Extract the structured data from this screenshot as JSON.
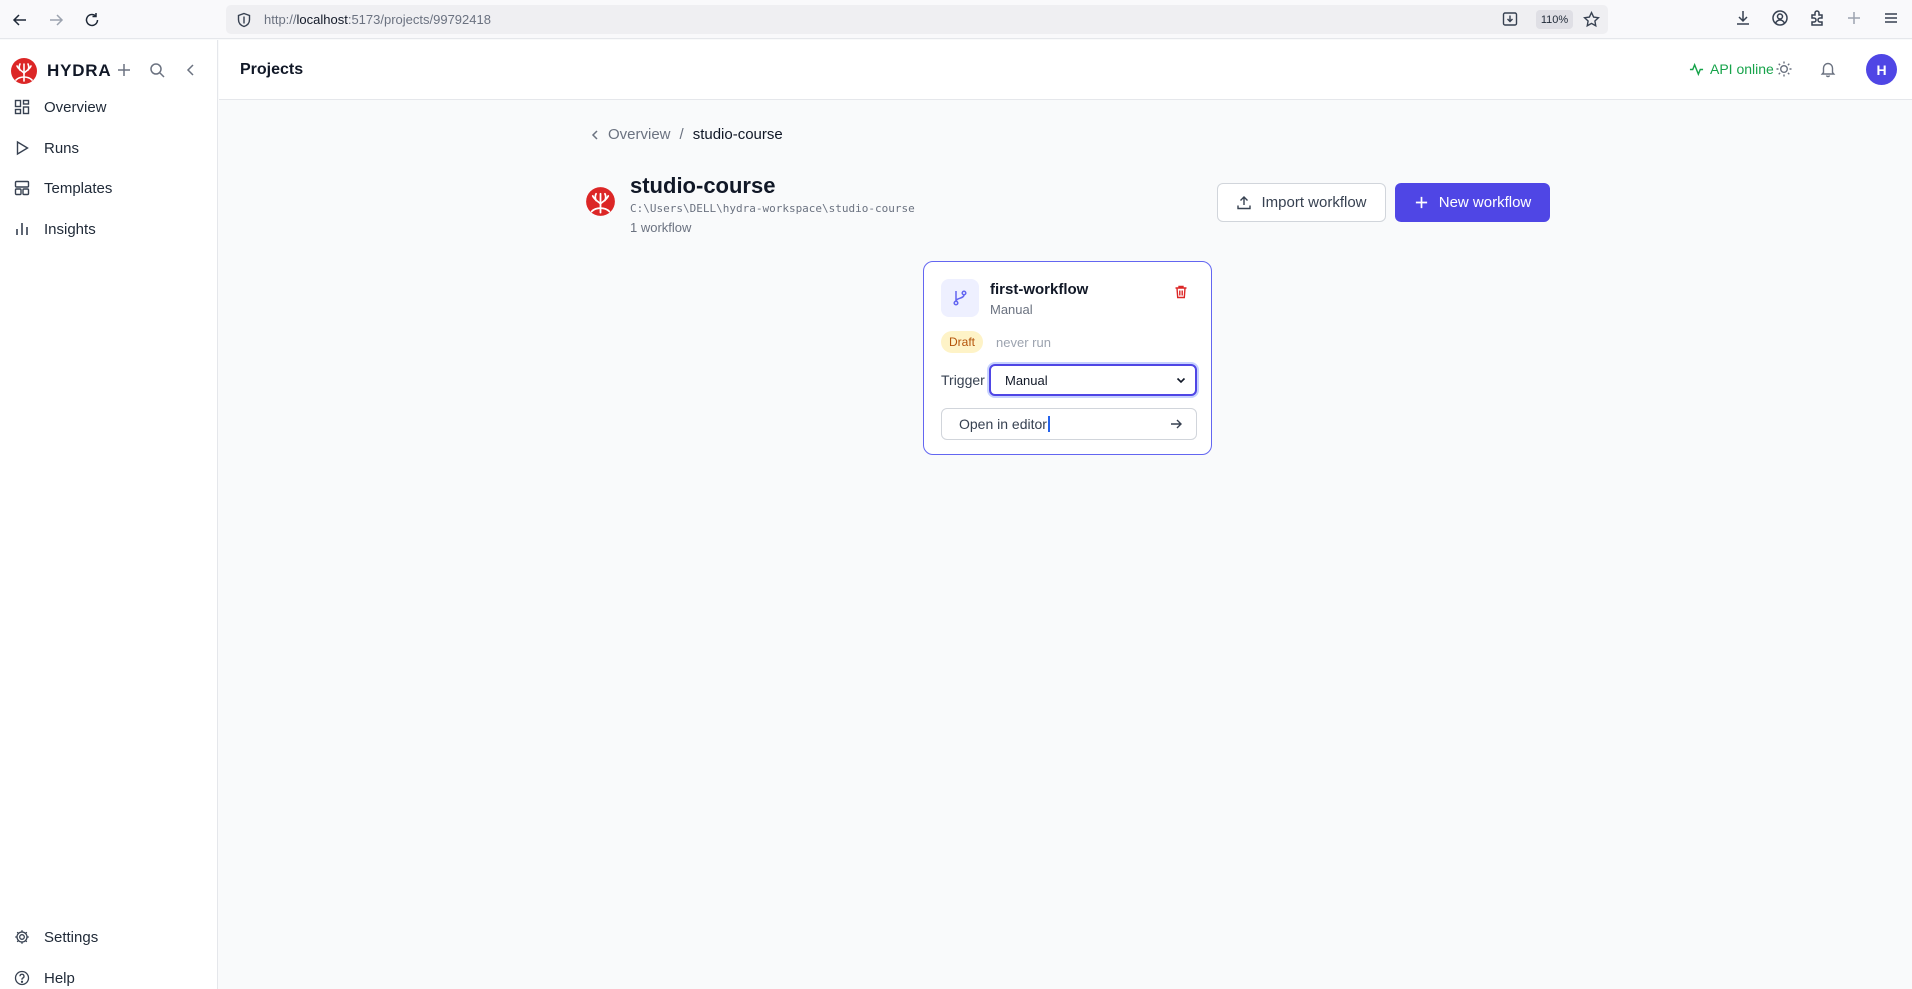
{
  "browser": {
    "url_prefix": "http://",
    "url_host": "localhost",
    "url_rest": ":5173/projects/99792418",
    "zoom": "110%"
  },
  "sidebar": {
    "brand": "HYDRA",
    "items": [
      {
        "label": "Overview",
        "icon": "overview-icon"
      },
      {
        "label": "Runs",
        "icon": "play-icon"
      },
      {
        "label": "Templates",
        "icon": "templates-icon"
      },
      {
        "label": "Insights",
        "icon": "chart-icon"
      }
    ],
    "footer": [
      {
        "label": "Settings",
        "icon": "gear-icon"
      },
      {
        "label": "Help",
        "icon": "help-icon"
      }
    ]
  },
  "header": {
    "title": "Projects",
    "api_status": "API online",
    "avatar": "H",
    "status_color": "#16a34a",
    "accent_color": "#4f46e5"
  },
  "breadcrumb": {
    "parent": "Overview",
    "separator": "/",
    "current": "studio-course"
  },
  "project": {
    "name": "studio-course",
    "path": "C:\\Users\\DELL\\hydra-workspace\\studio-course",
    "count": "1 workflow",
    "import_label": "Import workflow",
    "new_label": "New workflow"
  },
  "workflow": {
    "name": "first-workflow",
    "subtitle": "Manual",
    "status": "Draft",
    "last_run": "never run",
    "trigger_label": "Trigger",
    "trigger_value": "Manual",
    "open_label": "Open in editor"
  }
}
